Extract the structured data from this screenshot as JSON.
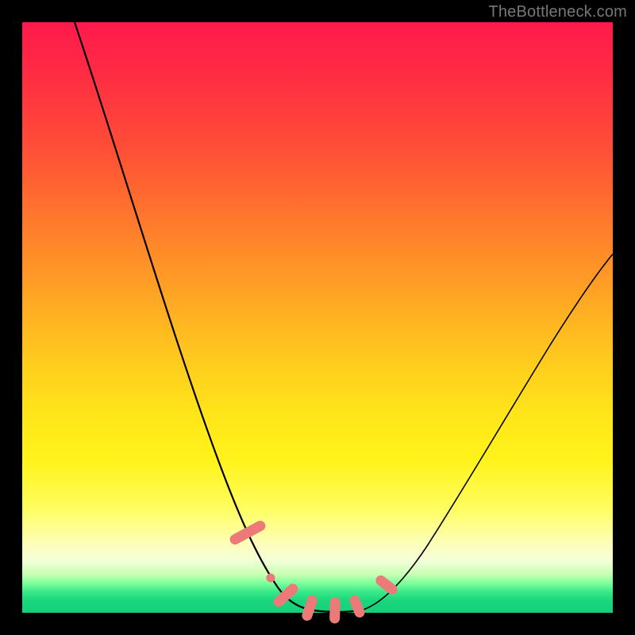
{
  "watermark": "TheBottleneck.com",
  "colors": {
    "frame": "#000000",
    "curve": "#000000",
    "marker": "#eb7a78",
    "gradient_top": "#ff1a4d",
    "gradient_mid": "#ffe41a",
    "gradient_bottom": "#16cf7a"
  },
  "chart_data": {
    "type": "line",
    "title": "",
    "xlabel": "",
    "ylabel": "",
    "x": [
      0.0,
      0.05,
      0.1,
      0.15,
      0.2,
      0.25,
      0.3,
      0.35,
      0.38,
      0.41,
      0.44,
      0.47,
      0.5,
      0.53,
      0.56,
      0.6,
      0.65,
      0.7,
      0.75,
      0.8,
      0.85,
      0.9,
      0.95,
      1.0
    ],
    "values": [
      1.0,
      0.9,
      0.79,
      0.67,
      0.55,
      0.42,
      0.3,
      0.18,
      0.11,
      0.06,
      0.03,
      0.01,
      0.0,
      0.0,
      0.01,
      0.03,
      0.08,
      0.15,
      0.23,
      0.32,
      0.41,
      0.49,
      0.56,
      0.62
    ],
    "xlim": [
      0,
      1
    ],
    "ylim": [
      0,
      1
    ],
    "grid": false,
    "legend": false,
    "annotations": [
      {
        "name": "left-descent-marker",
        "x": 0.375,
        "y": 0.095
      },
      {
        "name": "valley-marker-1",
        "x": 0.43,
        "y": 0.03
      },
      {
        "name": "valley-marker-2",
        "x": 0.47,
        "y": 0.005
      },
      {
        "name": "valley-marker-3",
        "x": 0.51,
        "y": 0.0
      },
      {
        "name": "valley-marker-4",
        "x": 0.545,
        "y": 0.005
      },
      {
        "name": "right-ascent-marker",
        "x": 0.6,
        "y": 0.045
      }
    ]
  }
}
